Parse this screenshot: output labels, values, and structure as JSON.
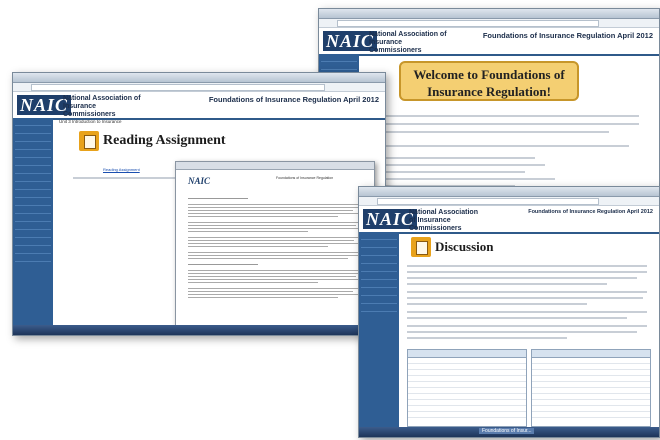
{
  "org_name": "National Association of Insurance Commissioners",
  "logo_text": "NAIC",
  "course_title": "Foundations of Insurance Regulation April 2012",
  "back_window": {
    "welcome_banner": "Welcome to Foundations of Insurance Regulation!"
  },
  "left_window": {
    "module_title": "Unit 3 Introduction to Insurance",
    "heading": "Reading Assignment",
    "doc_title": "Foundations of Insurance Regulation",
    "reading_link": "Reading Assignment"
  },
  "front_window": {
    "heading": "Discussion",
    "taskbar_tab": "Foundations of Insur..."
  },
  "colors": {
    "nav_blue": "#2f5e94",
    "header_navy": "#1f3f6b",
    "accent_orange": "#e8a21b",
    "banner_gold": "#f4cf72"
  },
  "icons": [
    "book-icon",
    "discussion-icon",
    "document-icon"
  ]
}
